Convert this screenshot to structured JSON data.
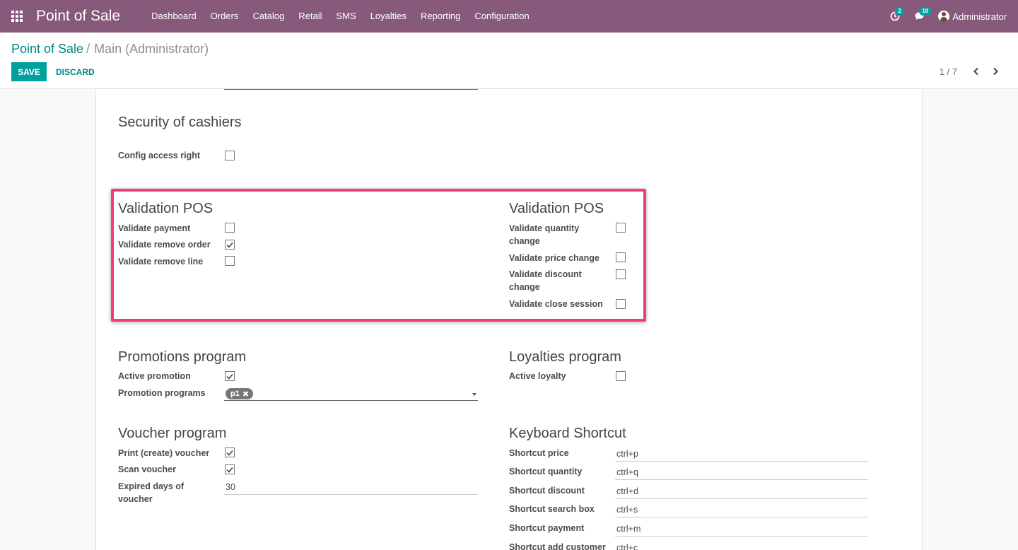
{
  "navbar": {
    "brand": "Point of Sale",
    "menu": [
      "Dashboard",
      "Orders",
      "Catalog",
      "Retail",
      "SMS",
      "Loyalties",
      "Reporting",
      "Configuration"
    ],
    "activity_count": "2",
    "messages_count": "10",
    "user": "Administrator"
  },
  "control": {
    "breadcrumb_parent": "Point of Sale",
    "breadcrumb_separator": "/",
    "breadcrumb_current": "Main (Administrator)",
    "save_label": "SAVE",
    "discard_label": "DISCARD",
    "pager": "1 / 7"
  },
  "security": {
    "title": "Security of cashiers",
    "config_access_right": {
      "label": "Config access right",
      "checked": false
    }
  },
  "validation_left": {
    "title": "Validation POS",
    "items": [
      {
        "label": "Validate payment",
        "checked": false
      },
      {
        "label": "Validate remove order",
        "checked": true
      },
      {
        "label": "Validate remove line",
        "checked": false
      }
    ]
  },
  "validation_right": {
    "title": "Validation POS",
    "items": [
      {
        "label_line1": "Validate quantity",
        "label_line2": "change",
        "checked": false
      },
      {
        "label_line1": "Validate price change",
        "label_line2": "",
        "checked": false
      },
      {
        "label_line1": "Validate discount",
        "label_line2": "change",
        "checked": false
      },
      {
        "label_line1": "Validate close session",
        "label_line2": "",
        "checked": false
      }
    ]
  },
  "promotions": {
    "title": "Promotions program",
    "active_promotion": {
      "label": "Active promotion",
      "checked": true
    },
    "promotion_programs": {
      "label": "Promotion programs",
      "tags": [
        "p1"
      ]
    }
  },
  "loyalties": {
    "title": "Loyalties program",
    "active_loyalty": {
      "label": "Active loyalty",
      "checked": false
    }
  },
  "voucher": {
    "title": "Voucher program",
    "print_voucher": {
      "label": "Print (create) voucher",
      "checked": true
    },
    "scan_voucher": {
      "label": "Scan voucher",
      "checked": true
    },
    "expired_days": {
      "label_line1": "Expired days of",
      "label_line2": "voucher",
      "value": "30"
    }
  },
  "shortcuts": {
    "title": "Keyboard Shortcut",
    "items": [
      {
        "label": "Shortcut price",
        "value": "ctrl+p"
      },
      {
        "label": "Shortcut quantity",
        "value": "ctrl+q"
      },
      {
        "label": "Shortcut discount",
        "value": "ctrl+d"
      },
      {
        "label": "Shortcut search box",
        "value": "ctrl+s"
      },
      {
        "label": "Shortcut payment",
        "value": "ctrl+m"
      },
      {
        "label": "Shortcut add customer",
        "value": "ctrl+c"
      }
    ]
  },
  "colors": {
    "navbar": "#875a7b",
    "primary": "#00a09d",
    "highlight_border": "#ee3e6d"
  }
}
